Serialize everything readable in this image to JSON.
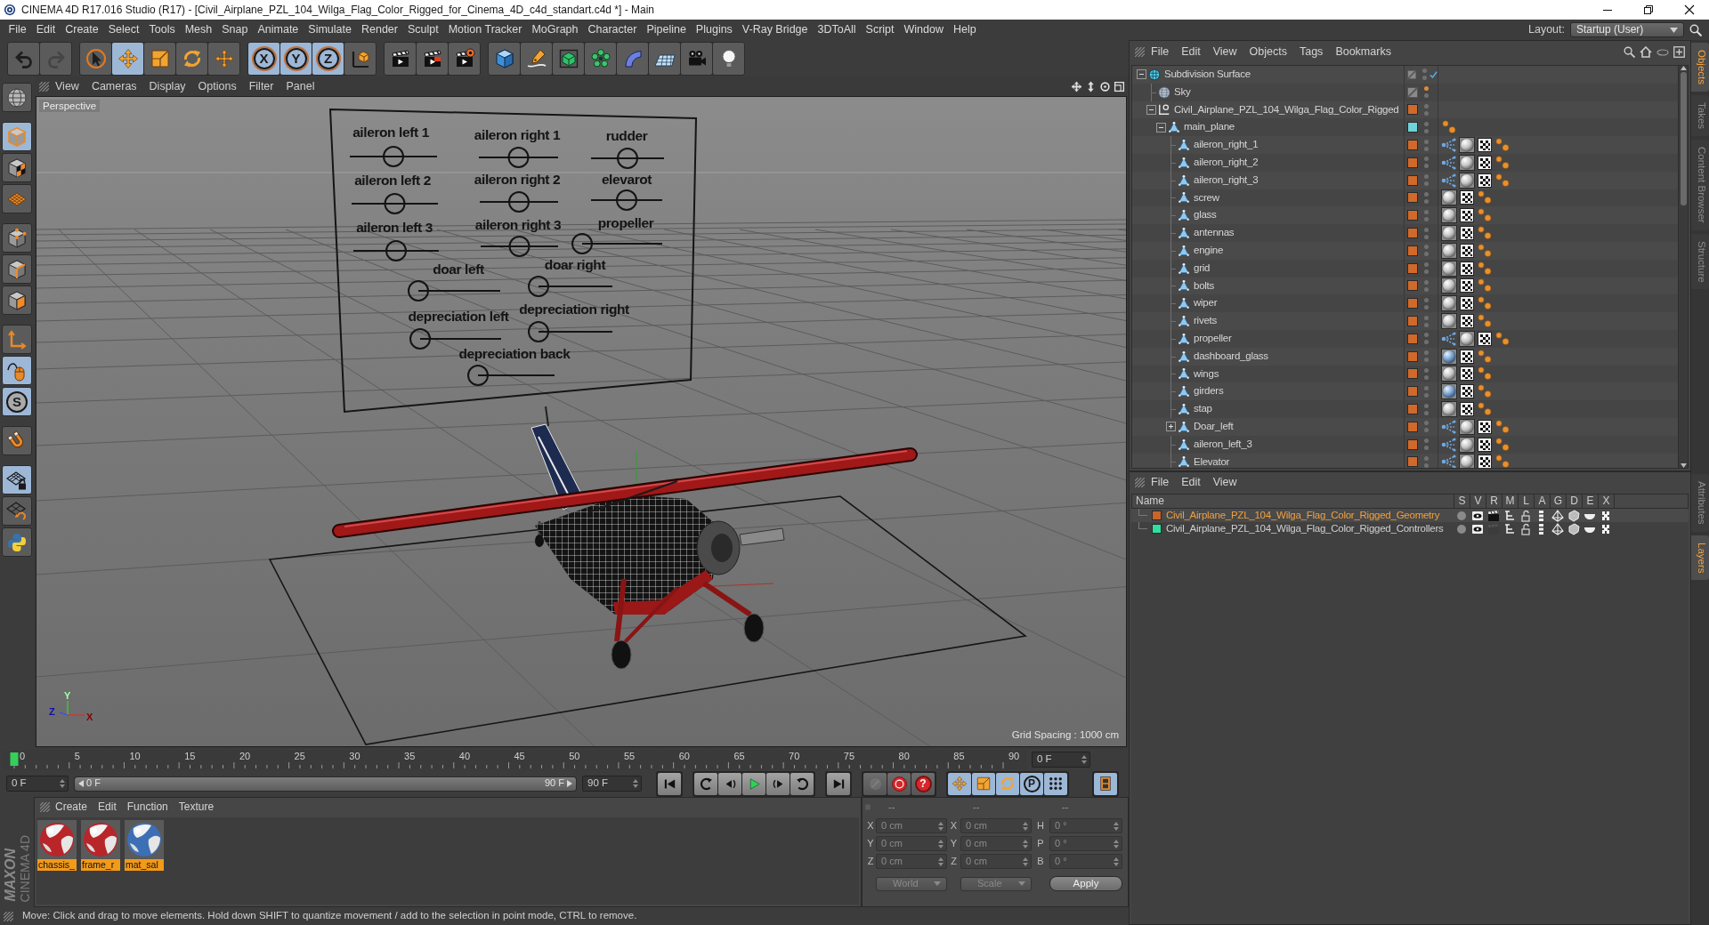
{
  "window": {
    "title": "CINEMA 4D R17.016 Studio (R17) - [Civil_Airplane_PZL_104_Wilga_Flag_Color_Rigged_for_Cinema_4D_c4d_standart.c4d *] - Main"
  },
  "menu_bar": {
    "items": [
      "File",
      "Edit",
      "Create",
      "Select",
      "Tools",
      "Mesh",
      "Snap",
      "Animate",
      "Simulate",
      "Render",
      "Sculpt",
      "Motion Tracker",
      "MoGraph",
      "Character",
      "Pipeline",
      "Plugins",
      "V-Ray Bridge",
      "3DToAll",
      "Script",
      "Window",
      "Help"
    ],
    "layout_label": "Layout:",
    "layout_value": "Startup (User)"
  },
  "toolbar": [
    [
      {
        "kind": "undo",
        "disabled": false
      },
      {
        "kind": "redo",
        "disabled": true
      }
    ],
    [
      {
        "kind": "select",
        "on": false
      },
      {
        "kind": "move",
        "on": true
      },
      {
        "kind": "scale",
        "on": false
      },
      {
        "kind": "rotate",
        "on": false
      },
      {
        "kind": "transform",
        "on": false
      }
    ],
    [
      {
        "kind": "axis",
        "label": "X",
        "on": true
      },
      {
        "kind": "axis",
        "label": "Y",
        "on": true
      },
      {
        "kind": "axis",
        "label": "Z",
        "on": true
      },
      {
        "kind": "coord",
        "on": false
      }
    ],
    [
      {
        "kind": "render-view",
        "on": false
      },
      {
        "kind": "render-pv",
        "on": false
      },
      {
        "kind": "render-settings",
        "on": false
      }
    ],
    [
      {
        "kind": "cube",
        "on": false
      },
      {
        "kind": "pen",
        "on": false
      },
      {
        "kind": "subdiv",
        "on": false
      },
      {
        "kind": "cloner",
        "on": false
      },
      {
        "kind": "deformer",
        "on": false
      },
      {
        "kind": "floor",
        "on": false
      },
      {
        "kind": "camera",
        "on": false
      },
      {
        "kind": "light",
        "on": false
      }
    ]
  ],
  "left_toolbar": [
    [
      {
        "kind": "globe",
        "on": false
      }
    ],
    [
      {
        "kind": "model",
        "on": true
      },
      {
        "kind": "texture",
        "on": false
      },
      {
        "kind": "workplane",
        "on": false
      }
    ],
    [
      {
        "kind": "points",
        "on": false
      },
      {
        "kind": "edges",
        "on": false
      },
      {
        "kind": "polygons",
        "on": false
      }
    ],
    [
      {
        "kind": "axis-mode",
        "on": false
      },
      {
        "kind": "tweak",
        "on": true
      },
      {
        "kind": "snap",
        "label": "S",
        "on": true
      }
    ],
    [
      {
        "kind": "magnet",
        "on": false
      }
    ],
    [
      {
        "kind": "lock-grid",
        "on": true
      },
      {
        "kind": "planar",
        "on": false
      },
      {
        "kind": "python",
        "on": false
      }
    ]
  ],
  "viewport": {
    "menu": [
      "View",
      "Cameras",
      "Display",
      "Options",
      "Filter",
      "Panel"
    ],
    "camera": "Perspective",
    "grid_spacing": "Grid Spacing : 1000 cm",
    "axes": [
      "Y",
      "Z",
      "X"
    ],
    "controllers": [
      {
        "label": "aileron left 1",
        "level": 0.5
      },
      {
        "label": "aileron right 1",
        "level": 0.5
      },
      {
        "label": "rudder",
        "level": 0.5
      },
      {
        "label": "aileron left 2",
        "level": 0.5
      },
      {
        "label": "aileron right 2",
        "level": 0.5
      },
      {
        "label": "elevarot",
        "level": 0.5
      },
      {
        "label": "aileron left 3",
        "level": 0.5
      },
      {
        "label": "aileron right 3",
        "level": 0.5
      },
      {
        "label": "propeller",
        "level": 0
      },
      {
        "label": "doar left",
        "level": 0
      },
      {
        "label": "doar right",
        "level": 0
      },
      {
        "label": "depreciation left",
        "level": 0
      },
      {
        "label": "depreciation right",
        "level": 0
      },
      {
        "label": "depreciation back",
        "level": 0
      }
    ]
  },
  "timeline": {
    "ticks": [
      "0",
      "5",
      "10",
      "15",
      "20",
      "25",
      "30",
      "35",
      "40",
      "45",
      "50",
      "55",
      "60",
      "65",
      "70",
      "75",
      "80",
      "85",
      "90"
    ],
    "playhead": {
      "level": 0
    },
    "frame_field": "0 F",
    "start_field": "0 F",
    "range": {
      "start": "0 F",
      "end": "90 F",
      "level": 1
    },
    "end_field": "90 F",
    "transport": [
      [
        {
          "kind": "start"
        }
      ],
      [
        {
          "kind": "prev-key"
        },
        {
          "kind": "step-back"
        },
        {
          "kind": "play"
        },
        {
          "kind": "step-forward"
        },
        {
          "kind": "next-key"
        }
      ],
      [
        {
          "kind": "end"
        }
      ]
    ],
    "key_tools": [
      {
        "kind": "keys",
        "disabled": true
      },
      {
        "kind": "record",
        "disabled": false
      },
      {
        "kind": "autokey",
        "label": "?",
        "disabled": false
      }
    ],
    "key_modes": [
      {
        "kind": "move",
        "on": true
      },
      {
        "kind": "scale",
        "on": true
      },
      {
        "kind": "rotate",
        "on": true
      },
      {
        "kind": "param",
        "label": "P",
        "on": true
      },
      {
        "kind": "pla",
        "on": true
      }
    ],
    "timeline_button": {
      "kind": "film",
      "on": true
    }
  },
  "logo": {
    "brand": "MAXON",
    "product": "CINEMA 4D"
  },
  "materials": {
    "menu": [
      "Create",
      "Edit",
      "Function",
      "Texture"
    ],
    "items": [
      {
        "name": "chassis_",
        "color": "#b8262a",
        "selected": true
      },
      {
        "name": "frame_r",
        "color": "#b8262a",
        "selected": true
      },
      {
        "name": "mat_sal",
        "color": "#3d6fb5",
        "selected": true
      }
    ]
  },
  "coordinates": {
    "headers": [
      "--",
      "--",
      "--"
    ],
    "rows": [
      {
        "labels": [
          "X",
          "X",
          "H"
        ],
        "values": [
          "0 cm",
          "0 cm",
          "0 °"
        ]
      },
      {
        "labels": [
          "Y",
          "Y",
          "P"
        ],
        "values": [
          "0 cm",
          "0 cm",
          "0 °"
        ]
      },
      {
        "labels": [
          "Z",
          "Z",
          "B"
        ],
        "values": [
          "0 cm",
          "0 cm",
          "0 °"
        ]
      }
    ],
    "dropdowns": [
      "World",
      "Scale"
    ],
    "apply": "Apply"
  },
  "status_bar": "Move: Click and drag to move elements. Hold down SHIFT to quantize movement / add to the selection in point mode, CTRL to remove.",
  "object_manager": {
    "menu": [
      "File",
      "Edit",
      "View",
      "Objects",
      "Tags",
      "Bookmarks"
    ],
    "objects": [
      {
        "name": "Subdivision Surface",
        "kind": "subdivision",
        "checked": true,
        "expanded": true,
        "children": [
          {
            "name": "Sky",
            "kind": "sky",
            "editor_dot": {
              "color": "#e08a3a"
            }
          },
          {
            "name": "Civil_Airplane_PZL_104_Wilga_Flag_Color_Rigged",
            "kind": "null",
            "color": "#d0692a",
            "expanded": true,
            "children": [
              {
                "name": "main_plane",
                "kind": "joint",
                "color": "#6fd2da",
                "expanded": true,
                "tags": [
                  {
                    "kind": "pose"
                  }
                ],
                "children": [
                  {
                    "name": "aileron_right_1",
                    "kind": "joint",
                    "color": "#d0692a",
                    "tags": [
                      {
                        "kind": "constraint"
                      },
                      {
                        "kind": "material"
                      },
                      {
                        "kind": "uvw"
                      },
                      {
                        "kind": "pose"
                      }
                    ]
                  },
                  {
                    "name": "aileron_right_2",
                    "kind": "joint",
                    "color": "#d0692a",
                    "tags": [
                      {
                        "kind": "constraint"
                      },
                      {
                        "kind": "material"
                      },
                      {
                        "kind": "uvw"
                      },
                      {
                        "kind": "pose"
                      }
                    ]
                  },
                  {
                    "name": "aileron_right_3",
                    "kind": "joint",
                    "color": "#d0692a",
                    "tags": [
                      {
                        "kind": "constraint"
                      },
                      {
                        "kind": "material"
                      },
                      {
                        "kind": "uvw"
                      },
                      {
                        "kind": "pose"
                      }
                    ]
                  },
                  {
                    "name": "screw",
                    "kind": "joint",
                    "color": "#d0692a",
                    "tags": [
                      {
                        "kind": "material"
                      },
                      {
                        "kind": "uvw"
                      },
                      {
                        "kind": "pose"
                      }
                    ]
                  },
                  {
                    "name": "glass",
                    "kind": "joint",
                    "color": "#d0692a",
                    "tags": [
                      {
                        "kind": "material"
                      },
                      {
                        "kind": "uvw"
                      },
                      {
                        "kind": "pose"
                      }
                    ]
                  },
                  {
                    "name": "antennas",
                    "kind": "joint",
                    "color": "#d0692a",
                    "tags": [
                      {
                        "kind": "material"
                      },
                      {
                        "kind": "uvw"
                      },
                      {
                        "kind": "pose"
                      }
                    ]
                  },
                  {
                    "name": "engine",
                    "kind": "joint",
                    "color": "#d0692a",
                    "tags": [
                      {
                        "kind": "material"
                      },
                      {
                        "kind": "uvw"
                      },
                      {
                        "kind": "pose"
                      }
                    ]
                  },
                  {
                    "name": "grid",
                    "kind": "joint",
                    "color": "#d0692a",
                    "tags": [
                      {
                        "kind": "material"
                      },
                      {
                        "kind": "uvw"
                      },
                      {
                        "kind": "pose"
                      }
                    ]
                  },
                  {
                    "name": "bolts",
                    "kind": "joint",
                    "color": "#d0692a",
                    "tags": [
                      {
                        "kind": "material"
                      },
                      {
                        "kind": "uvw"
                      },
                      {
                        "kind": "pose"
                      }
                    ]
                  },
                  {
                    "name": "wiper",
                    "kind": "joint",
                    "color": "#d0692a",
                    "tags": [
                      {
                        "kind": "material"
                      },
                      {
                        "kind": "uvw"
                      },
                      {
                        "kind": "pose"
                      }
                    ]
                  },
                  {
                    "name": "rivets",
                    "kind": "joint",
                    "color": "#d0692a",
                    "tags": [
                      {
                        "kind": "material"
                      },
                      {
                        "kind": "uvw"
                      },
                      {
                        "kind": "pose"
                      }
                    ]
                  },
                  {
                    "name": "propeller",
                    "kind": "joint",
                    "color": "#d0692a",
                    "tags": [
                      {
                        "kind": "constraint"
                      },
                      {
                        "kind": "material"
                      },
                      {
                        "kind": "uvw"
                      },
                      {
                        "kind": "pose"
                      }
                    ]
                  },
                  {
                    "name": "dashboard_glass",
                    "kind": "joint",
                    "color": "#d0692a",
                    "tags": [
                      {
                        "kind": "material-blue"
                      },
                      {
                        "kind": "uvw"
                      },
                      {
                        "kind": "pose"
                      }
                    ]
                  },
                  {
                    "name": "wings",
                    "kind": "joint",
                    "color": "#d0692a",
                    "tags": [
                      {
                        "kind": "material"
                      },
                      {
                        "kind": "uvw"
                      },
                      {
                        "kind": "pose"
                      }
                    ]
                  },
                  {
                    "name": "girders",
                    "kind": "joint",
                    "color": "#d0692a",
                    "tags": [
                      {
                        "kind": "material-blue"
                      },
                      {
                        "kind": "uvw"
                      },
                      {
                        "kind": "pose"
                      }
                    ]
                  },
                  {
                    "name": "stap",
                    "kind": "joint",
                    "color": "#d0692a",
                    "tags": [
                      {
                        "kind": "material"
                      },
                      {
                        "kind": "uvw"
                      },
                      {
                        "kind": "pose"
                      }
                    ]
                  },
                  {
                    "name": "Doar_left",
                    "kind": "joint",
                    "color": "#d0692a",
                    "expanded": false,
                    "tags": [
                      {
                        "kind": "constraint"
                      },
                      {
                        "kind": "material"
                      },
                      {
                        "kind": "uvw"
                      },
                      {
                        "kind": "pose"
                      }
                    ]
                  },
                  {
                    "name": "aileron_left_3",
                    "kind": "joint",
                    "color": "#d0692a",
                    "tags": [
                      {
                        "kind": "constraint"
                      },
                      {
                        "kind": "material"
                      },
                      {
                        "kind": "uvw"
                      },
                      {
                        "kind": "pose"
                      }
                    ]
                  },
                  {
                    "name": "Elevator",
                    "kind": "joint",
                    "color": "#d0692a",
                    "tags": [
                      {
                        "kind": "constraint"
                      },
                      {
                        "kind": "material"
                      },
                      {
                        "kind": "uvw"
                      },
                      {
                        "kind": "pose"
                      }
                    ]
                  }
                ]
              }
            ]
          }
        ]
      }
    ]
  },
  "object_tabs": [
    {
      "label": "Objects",
      "selected": true
    },
    {
      "label": "Takes",
      "selected": false
    },
    {
      "label": "Content Browser",
      "selected": false
    },
    {
      "label": "Structure",
      "selected": false
    }
  ],
  "layer_manager": {
    "menu": [
      "File",
      "Edit",
      "View"
    ],
    "columns": [
      "Name",
      "S",
      "V",
      "R",
      "M",
      "L",
      "A",
      "G",
      "D",
      "E",
      "X"
    ],
    "layers": [
      {
        "name": "Civil_Airplane_PZL_104_Wilga_Flag_Color_Rigged_Geometry",
        "color": "#c8642a",
        "selected": true,
        "render": true
      },
      {
        "name": "Civil_Airplane_PZL_104_Wilga_Flag_Color_Rigged_Controllers",
        "color": "#2ee0a0",
        "selected": false,
        "render": false
      }
    ]
  },
  "layer_tabs": [
    {
      "label": "Attributes",
      "selected": false
    },
    {
      "label": "Layers",
      "selected": true
    }
  ]
}
